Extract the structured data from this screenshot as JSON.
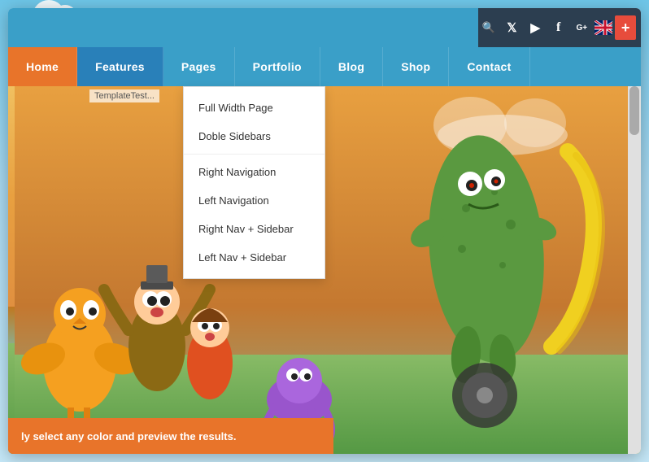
{
  "topBar": {
    "socialIcons": [
      {
        "name": "search",
        "symbol": "🔍",
        "label": "Search"
      },
      {
        "name": "twitter",
        "symbol": "𝕏",
        "label": "Twitter"
      },
      {
        "name": "youtube",
        "symbol": "▶",
        "label": "YouTube"
      },
      {
        "name": "facebook",
        "symbol": "f",
        "label": "Facebook"
      },
      {
        "name": "google-plus",
        "symbol": "G+",
        "label": "Google Plus"
      },
      {
        "name": "flag",
        "symbol": "🇬🇧",
        "label": "Language"
      },
      {
        "name": "plus",
        "symbol": "+",
        "label": "Add"
      }
    ]
  },
  "nav": {
    "items": [
      {
        "label": "Home",
        "active": true,
        "class": "home"
      },
      {
        "label": "Features",
        "active": false,
        "dropdown": true,
        "class": "features"
      },
      {
        "label": "Pages",
        "active": false,
        "class": "pages"
      },
      {
        "label": "Portfolio",
        "active": false,
        "class": "portfolio"
      },
      {
        "label": "Blog",
        "active": false,
        "class": "blog"
      },
      {
        "label": "Shop",
        "active": false,
        "class": "shop"
      },
      {
        "label": "Contact",
        "active": false,
        "class": "contact"
      }
    ]
  },
  "dropdown": {
    "items": [
      {
        "label": "Full Width Page",
        "separator": false
      },
      {
        "label": "Doble Sidebars",
        "separator": false
      },
      {
        "label": "Right Navigation",
        "separator": true
      },
      {
        "label": "Left Navigation",
        "separator": false
      },
      {
        "label": "Right Nav + Sidebar",
        "separator": false
      },
      {
        "label": "Left Nav + Sidebar",
        "separator": false
      }
    ]
  },
  "hero": {
    "bottomText": "ly select any color and preview the results."
  },
  "templateLabel": "TemplateTest..."
}
